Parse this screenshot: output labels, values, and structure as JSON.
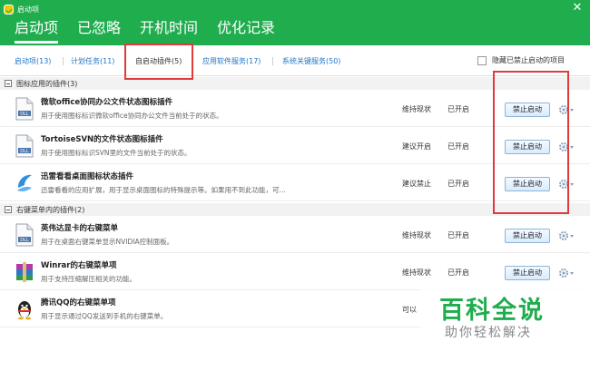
{
  "window": {
    "title": "启动项",
    "close": "✕"
  },
  "main_tabs": [
    {
      "label": "启动项",
      "active": true
    },
    {
      "label": "已忽略"
    },
    {
      "label": "开机时间"
    },
    {
      "label": "优化记录"
    }
  ],
  "sub_tabs": [
    {
      "label": "启动项(13)"
    },
    {
      "label": "计划任务(11)"
    },
    {
      "label": "自启动插件(5)",
      "active": true
    },
    {
      "label": "应用软件服务(17)"
    },
    {
      "label": "系统关键服务(50)"
    }
  ],
  "hide_disabled": {
    "label": "隐藏已禁止启动的项目",
    "checked": false
  },
  "groups": [
    {
      "title": "图标应用的插件(3)",
      "items": [
        {
          "icon": "dll-file-icon",
          "name": "微软office协同办公文件状态图标插件",
          "desc": "用于使用图标标识微软office协同办公文件当前处于的状态。",
          "advice": "维持现状",
          "status": "已开启",
          "button": "禁止启动"
        },
        {
          "icon": "dll-file-icon",
          "name": "TortoiseSVN的文件状态图标插件",
          "desc": "用于使用图标标识SVN里的文件当前处于的状态。",
          "advice": "建议开启",
          "status": "已开启",
          "button": "禁止启动"
        },
        {
          "icon": "xunlei-icon",
          "name": "迅雷看看桌面图标状态插件",
          "desc": "迅雷看看的应用扩展，用于显示桌面图标的特殊提示等。如果用不到此功能，可...",
          "advice": "建议禁止",
          "status": "已开启",
          "button": "禁止启动"
        }
      ]
    },
    {
      "title": "右键菜单内的插件(2)",
      "items": [
        {
          "icon": "dll-file-icon",
          "name": "英伟达显卡的右键菜单",
          "desc": "用于在桌面右键菜单显示NVIDIA控制面板。",
          "advice": "维持现状",
          "status": "已开启",
          "button": "禁止启动"
        },
        {
          "icon": "winrar-icon",
          "name": "Winrar的右键菜单项",
          "desc": "用于支持压缩解压相关的功能。",
          "advice": "维持现状",
          "status": "已开启",
          "button": "禁止启动"
        },
        {
          "icon": "qq-penguin-icon",
          "name": "腾讯QQ的右键菜单项",
          "desc": "用于显示通过QQ发送到手机的右键菜单。",
          "advice": "可以",
          "status": "",
          "button": ""
        }
      ]
    }
  ],
  "watermark": {
    "main": "百科全说",
    "sub": "助你轻松解决"
  },
  "colors": {
    "header": "#1fad4e",
    "link": "#2276c8",
    "annotation": "#e03a3a"
  }
}
